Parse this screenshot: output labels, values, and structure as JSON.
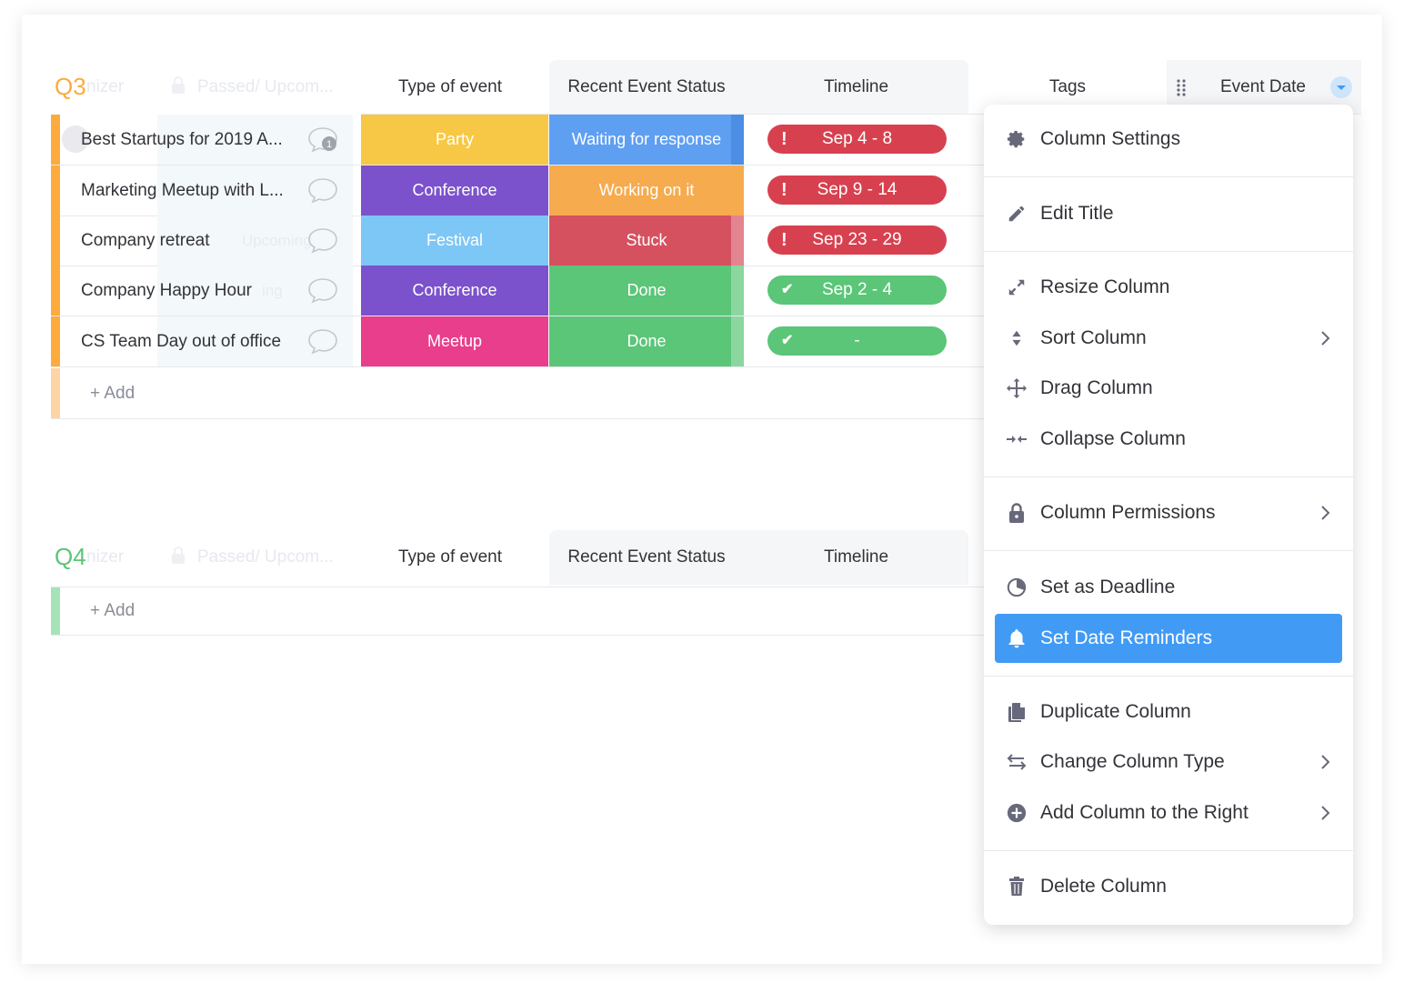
{
  "groups": [
    {
      "title": "Q3",
      "color": "#fdab3d",
      "ghost_owner": "nizer",
      "ghost_passed": "Passed/ Upcom...",
      "columns": {
        "type": "Type of event",
        "status": "Recent Event Status",
        "timeline": "Timeline",
        "tags": "Tags",
        "event_date": "Event Date"
      },
      "rows": [
        {
          "name": "Best Startups for 2019 A...",
          "ghost": "",
          "type": "Party",
          "type_color": "#f7c845",
          "status": "Waiting for response",
          "status_color": "#5f9ff2",
          "timeline": "Sep 4 - 8",
          "timeline_color": "#d7414f",
          "timeline_mark": "!",
          "updates": "1"
        },
        {
          "name": "Marketing Meetup with L...",
          "ghost": "",
          "type": "Conference",
          "type_color": "#7b52cc",
          "status": "Working on it",
          "status_color": "#f5ab4e",
          "timeline": "Sep 9 - 14",
          "timeline_color": "#d7414f",
          "timeline_mark": "!"
        },
        {
          "name": "Company retreat",
          "ghost": "Upcoming",
          "type": "Festival",
          "type_color": "#7dc7f7",
          "status": "Stuck",
          "status_color": "#d65160",
          "timeline": "Sep 23 - 29",
          "timeline_color": "#d7414f",
          "timeline_mark": "!"
        },
        {
          "name": "Company Happy Hour",
          "ghost": "ing",
          "type": "Conference",
          "type_color": "#7b52cc",
          "status": "Done",
          "status_color": "#5bc578",
          "timeline": "Sep 2 - 4",
          "timeline_color": "#5bc578",
          "timeline_mark": "✔"
        },
        {
          "name": "CS Team Day out of office",
          "ghost": "",
          "type": "Meetup",
          "type_color": "#e83e8c",
          "status": "Done",
          "status_color": "#5bc578",
          "timeline": "-",
          "timeline_color": "#5bc578",
          "timeline_mark": "✔"
        }
      ],
      "add_label": "+ Add"
    },
    {
      "title": "Q4",
      "color": "#5bc578",
      "ghost_owner": "nizer",
      "ghost_passed": "Passed/ Upcom...",
      "columns": {
        "type": "Type of event",
        "status": "Recent Event Status",
        "timeline": "Timeline"
      },
      "add_label": "+ Add"
    }
  ],
  "menu": {
    "items": [
      {
        "label": "Column Settings",
        "icon": "gear-icon"
      },
      {
        "label": "Edit Title",
        "icon": "pencil-icon"
      },
      {
        "label": "Resize Column",
        "icon": "resize-icon"
      },
      {
        "label": "Sort Column",
        "icon": "sort-icon",
        "submenu": true
      },
      {
        "label": "Drag Column",
        "icon": "move-icon"
      },
      {
        "label": "Collapse Column",
        "icon": "collapse-icon"
      },
      {
        "label": "Column Permissions",
        "icon": "lock-icon",
        "submenu": true
      },
      {
        "label": "Set as Deadline",
        "icon": "clock-icon"
      },
      {
        "label": "Set Date Reminders",
        "icon": "bell-icon",
        "active": true
      },
      {
        "label": "Duplicate Column",
        "icon": "duplicate-icon"
      },
      {
        "label": "Change Column Type",
        "icon": "swap-icon",
        "submenu": true
      },
      {
        "label": "Add Column to the Right",
        "icon": "plus-circle-icon",
        "submenu": true
      },
      {
        "label": "Delete Column",
        "icon": "trash-icon"
      }
    ],
    "active_color": "#419bf5"
  }
}
